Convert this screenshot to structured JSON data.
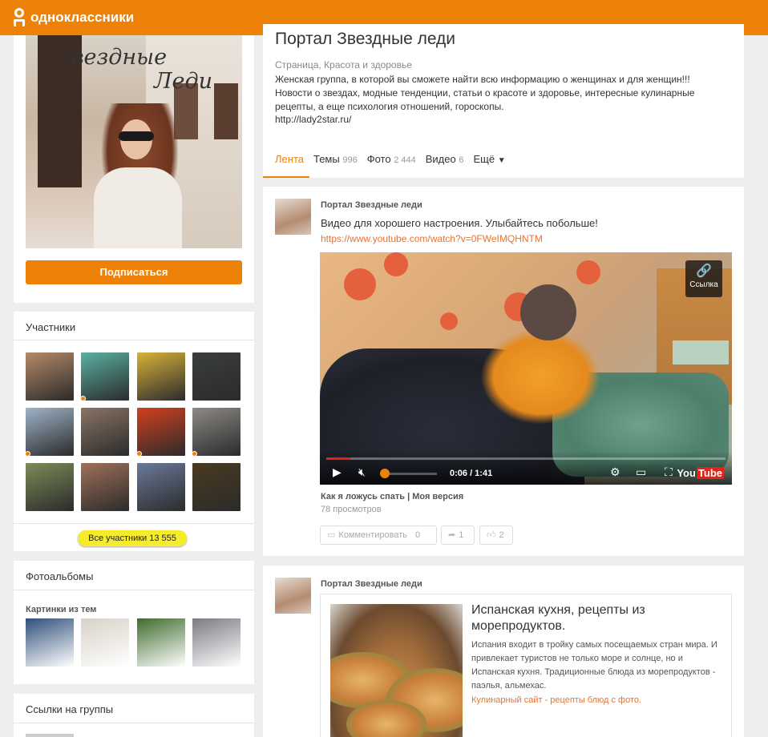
{
  "header": {
    "logo_text": "одноклассники",
    "brand_color": "#ee8208"
  },
  "profile": {
    "cover_line1": "Звездные",
    "cover_line2": "Леди",
    "subscribe_label": "Подписаться"
  },
  "members": {
    "title": "Участники",
    "all_label": "Все участники 13 555",
    "avatars": [
      {
        "color": "#b48a68",
        "online": false
      },
      {
        "color": "#5ab0a2",
        "online": true
      },
      {
        "color": "#d8b23a",
        "online": false
      },
      {
        "color": "#3a3e3a",
        "online": false
      },
      {
        "color": "#9fb3c8",
        "online": true
      },
      {
        "color": "#8a7464",
        "online": false
      },
      {
        "color": "#d2401d",
        "online": true
      },
      {
        "color": "#8d8a86",
        "online": true
      },
      {
        "color": "#7c8c58",
        "online": false
      },
      {
        "color": "#a0705a",
        "online": false
      },
      {
        "color": "#6a7a9a",
        "online": false
      },
      {
        "color": "#4a3a20",
        "online": false
      }
    ]
  },
  "albums": {
    "title": "Фотоальбомы",
    "subtitle": "Картинки из тем",
    "thumbs": [
      "#2f4f7a",
      "#d8d2c8",
      "#3f6b2e",
      "#7a7a82"
    ]
  },
  "links": {
    "title": "Ссылки на группы"
  },
  "group": {
    "title": "Портал Звездные леди",
    "category": "Страница, Красота и здоровье",
    "description": "Женская группа, в которой вы сможете найти всю информацию о женщинах и для женщин!!! Новости о звездах, модные тенденции, статьи о красоте и здоровье, интересные кулинарные рецепты, а еще психология отношений, гороскопы.",
    "url": "http://lady2star.ru/",
    "tabs": [
      {
        "label": "Лента",
        "count": ""
      },
      {
        "label": "Темы",
        "count": "996"
      },
      {
        "label": "Фото",
        "count": "2 444"
      },
      {
        "label": "Видео",
        "count": "6"
      },
      {
        "label": "Ещё",
        "count": ""
      }
    ]
  },
  "post1": {
    "author": "Портал Звездные леди",
    "text": "Видео для хорошего настроения. Улыбайтесь побольше!",
    "link": "https://www.youtube.com/watch?v=0FWeIMQHNTM",
    "video": {
      "badge_label": "Ссылка",
      "time": "0:06 / 1:41",
      "progress": 0.06,
      "volume": 0.0,
      "brand_you": "You",
      "brand_tube": "Tube"
    },
    "video_title": "Как я ложусь спать | Моя версия",
    "views": "78 просмотров",
    "comment_label": "Комментировать",
    "comment_count": "0",
    "share_count": "1",
    "like_count": "2"
  },
  "post2": {
    "author": "Портал Звездные леди",
    "share_title": "Испанская кухня, рецепты из морепродуктов.",
    "share_desc": "Испания входит в тройку самых посещаемых стран мира. И привлекает туристов не только море и солнце, но и Испанская кухня. Традиционные блюда из морепродуктов - паэлья, альмехас.",
    "share_source": "Кулинарный сайт - рецепты блюд с фото."
  }
}
